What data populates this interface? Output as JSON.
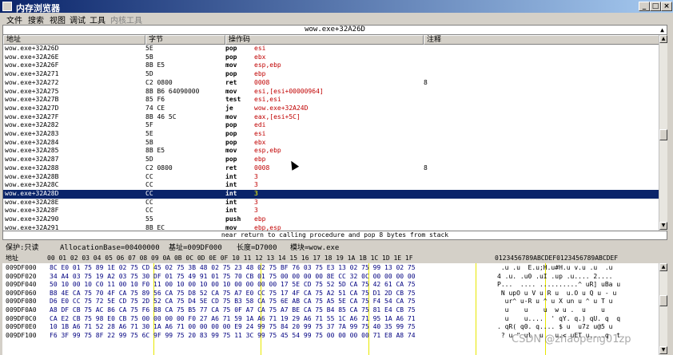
{
  "window": {
    "title": "内存浏览器"
  },
  "window_buttons": [
    "_",
    "□",
    "×"
  ],
  "menu": [
    {
      "label": "文件",
      "enabled": true
    },
    {
      "label": "搜索",
      "enabled": true
    },
    {
      "label": "视图",
      "enabled": true
    },
    {
      "label": "调试",
      "enabled": true
    },
    {
      "label": "工具",
      "enabled": true
    },
    {
      "label": "内核工具",
      "enabled": false
    }
  ],
  "disasm": {
    "caption": "wow.exe+32A26D",
    "columns": [
      "地址",
      "字节",
      "操作码",
      "注释"
    ],
    "selected_index": 17,
    "rows": [
      {
        "addr": "wow.exe+32A26D",
        "bytes": "5E",
        "mn": "pop",
        "ops": "esi",
        "comment": ""
      },
      {
        "addr": "wow.exe+32A26E",
        "bytes": "5B",
        "mn": "pop",
        "ops": "ebx",
        "comment": ""
      },
      {
        "addr": "wow.exe+32A26F",
        "bytes": "8B E5",
        "mn": "mov",
        "ops": "esp,ebp",
        "comment": ""
      },
      {
        "addr": "wow.exe+32A271",
        "bytes": "5D",
        "mn": "pop",
        "ops": "ebp",
        "comment": ""
      },
      {
        "addr": "wow.exe+32A272",
        "bytes": "C2 0800",
        "mn": "ret",
        "ops": "0008",
        "comment": "8"
      },
      {
        "addr": "wow.exe+32A275",
        "bytes": "8B B6 64090000",
        "mn": "mov",
        "ops": "esi,[esi+00000964]",
        "comment": ""
      },
      {
        "addr": "wow.exe+32A27B",
        "bytes": "85 F6",
        "mn": "test",
        "ops": "esi,esi",
        "comment": ""
      },
      {
        "addr": "wow.exe+32A27D",
        "bytes": "74 CE",
        "mn": "je",
        "ops": "wow.exe+32A24D",
        "comment": ""
      },
      {
        "addr": "wow.exe+32A27F",
        "bytes": "8B 46 5C",
        "mn": "mov",
        "ops": "eax,[esi+5C]",
        "comment": ""
      },
      {
        "addr": "wow.exe+32A282",
        "bytes": "5F",
        "mn": "pop",
        "ops": "edi",
        "comment": ""
      },
      {
        "addr": "wow.exe+32A283",
        "bytes": "5E",
        "mn": "pop",
        "ops": "esi",
        "comment": ""
      },
      {
        "addr": "wow.exe+32A284",
        "bytes": "5B",
        "mn": "pop",
        "ops": "ebx",
        "comment": ""
      },
      {
        "addr": "wow.exe+32A285",
        "bytes": "8B E5",
        "mn": "mov",
        "ops": "esp,ebp",
        "comment": ""
      },
      {
        "addr": "wow.exe+32A287",
        "bytes": "5D",
        "mn": "pop",
        "ops": "ebp",
        "comment": ""
      },
      {
        "addr": "wow.exe+32A288",
        "bytes": "C2 0800",
        "mn": "ret",
        "ops": "0008",
        "comment": "8"
      },
      {
        "addr": "wow.exe+32A28B",
        "bytes": "CC",
        "mn": "int",
        "ops": "3",
        "comment": ""
      },
      {
        "addr": "wow.exe+32A28C",
        "bytes": "CC",
        "mn": "int",
        "ops": "3",
        "comment": ""
      },
      {
        "addr": "wow.exe+32A28D",
        "bytes": "CC",
        "mn": "int",
        "ops": "3",
        "comment": ""
      },
      {
        "addr": "wow.exe+32A28E",
        "bytes": "CC",
        "mn": "int",
        "ops": "3",
        "comment": ""
      },
      {
        "addr": "wow.exe+32A28F",
        "bytes": "CC",
        "mn": "int",
        "ops": "3",
        "comment": ""
      },
      {
        "addr": "wow.exe+32A290",
        "bytes": "55",
        "mn": "push",
        "ops": "ebp",
        "comment": ""
      },
      {
        "addr": "wow.exe+32A291",
        "bytes": "8B EC",
        "mn": "mov",
        "ops": "ebp,esp",
        "comment": ""
      }
    ]
  },
  "status_text": "near return to calling procedure and pop 8 bytes from stack",
  "hexview": {
    "protect": "保护:只读",
    "alloc": "AllocationBase=00400000",
    "base": "基址=009DF000",
    "length": "长度=D7000",
    "module": "模块=wow.exe",
    "header_label": "地址",
    "header_bytes": "00 01 02 03 04 05 06 07 08 09 0A 0B 0C 0D 0E 0F 10 11 12 13 14 15 16 17 18 19 1A 1B 1C 1D 1E 1F",
    "header_ascii": "0123456789ABCDEF0123456789ABCDEF",
    "rows": [
      {
        "addr": "009DF000",
        "bytes": "8C E0 01 75 89 1E 02 75 CD 45 02 75 3B 48 02 75 23 48 02 75 BF 76 03 75 E3 13 02 75 99 13 02 75",
        "ascii": " .u .u  E.u;H.u#H.u v.u .u  .u"
      },
      {
        "addr": "009DF020",
        "bytes": "34 A4 03 75 19 A2 03 75 30 DF 01 75 49 91 01 75 70 CB 01 75 00 00 00 00 8E CC 32 0C 00 00 00 00",
        "ascii": "4 .u. .u0 .uI .up .u.... 2...."
      },
      {
        "addr": "009DF040",
        "bytes": "50 10 00 10 C0 11 00 10 F0 11 00 10 00 10 00 10 00 00 00 00 17 5E CD 75 52 5D CA 75 42 61 CA 75",
        "ascii": "P...  .... ..........^ uR] uBa u"
      },
      {
        "addr": "009DF060",
        "bytes": "B8 4E CA 75 70 4F CA 75 89 56 CA 75 D8 52 CA 75 A7 E0 CC 75 17 4F CA 75 A2 51 CA 75 D1 2D CB 75",
        "ascii": " N upO u V u R u  u.O u Q u - u"
      },
      {
        "addr": "009DF080",
        "bytes": "D6 E0 CC 75 72 5E CD 75 2D 52 CA 75 D4 5E CD 75 B3 58 CA 75 6E AB CA 75 A5 5E CA 75 F4 54 CA 75",
        "ascii": "  ur^ u-R u ^ u X un u ^ u T u"
      },
      {
        "addr": "009DF0A0",
        "bytes": "A8 DF CB 75 AC 86 CA 75 F6 88 CA 75 B5 77 CA 75 0F A7 CA 75 A7 BE CA 75 B4 85 CA 75 81 E4 CB 75",
        "ascii": "  u    u    u  w u .  u    u"
      },
      {
        "addr": "009DF0C0",
        "bytes": "CA E2 CB 75 98 E0 CB 75 00 00 00 00 F0 27 A6 71 59 1A A6 71 19 29 A6 71 55 1C A6 71 95 1A A6 71",
        "ascii": "  u    u....  ' qY. q.) qU. q  q"
      },
      {
        "addr": "009DF0E0",
        "bytes": "10 1B A6 71 52 28 A6 71 30 1A A6 71 00 00 00 00 E9 24 99 75 84 20 99 75 37 7A 99 75 40 35 99 75",
        "ascii": ". qR( q0. q.... $ u  u7z u@5 u"
      },
      {
        "addr": "009DF100",
        "bytes": "F6 3F 99 75 8F 22 99 75 6C 9F 99 75 20 83 99 75 11 3C 99 75 45 54 99 75 00 00 00 00 71 E8 A8 74",
        "ascii": " ? u \" ul  u   u.< uET u....q  t"
      }
    ]
  },
  "watermark": "CSDN @zhaopeng01zp"
}
